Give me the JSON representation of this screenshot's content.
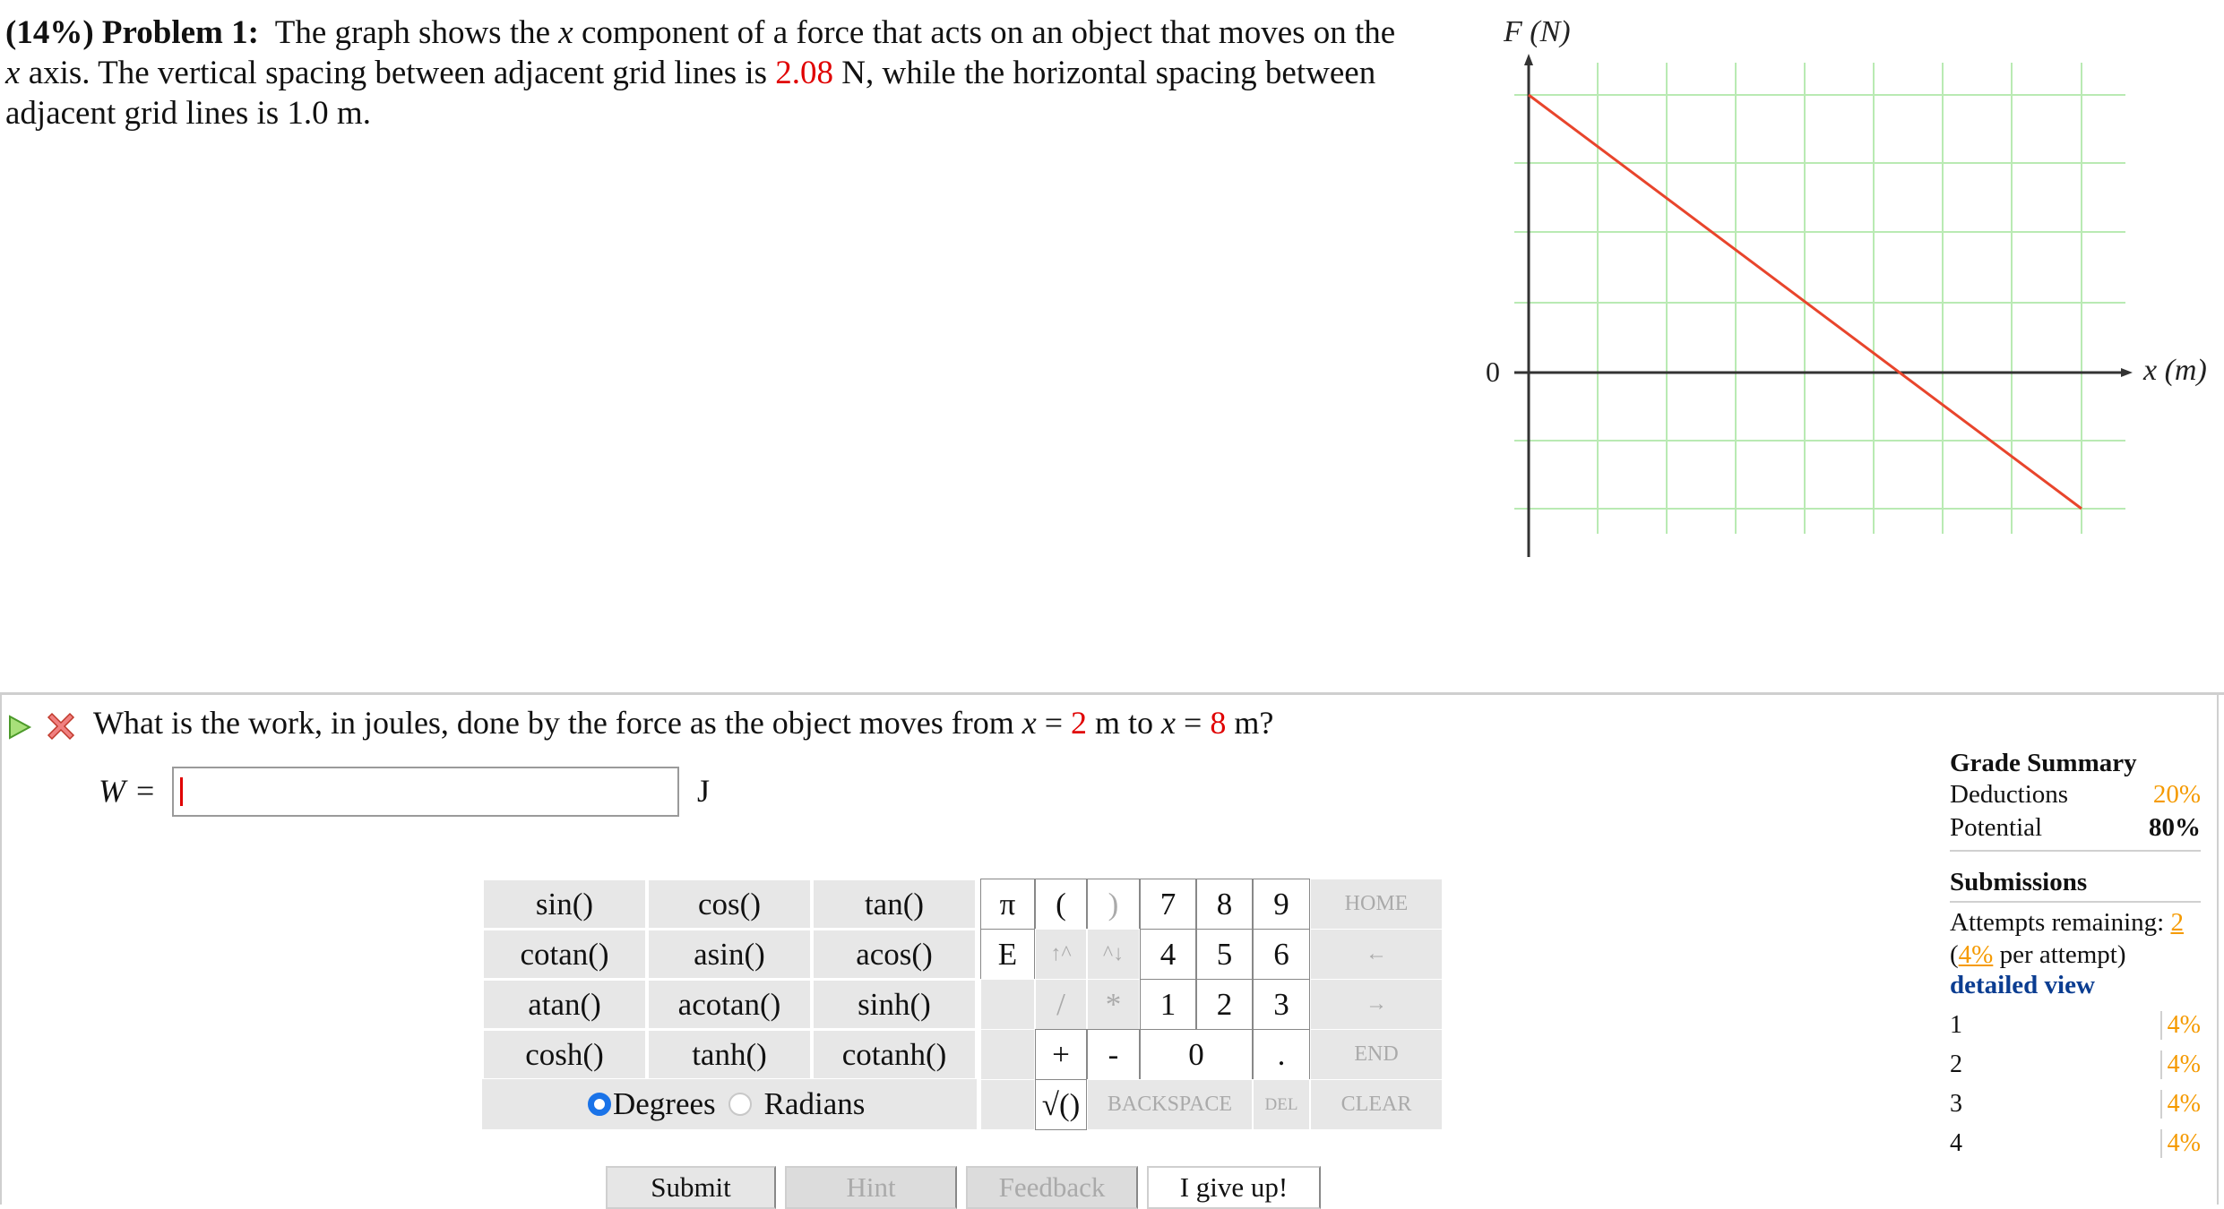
{
  "problem": {
    "weight": "(14%)",
    "title": "Problem 1:",
    "text_1": "The graph shows the",
    "var_x": "x",
    "text_2": "component of a force that acts on an object that moves on the",
    "var_x2": "x",
    "text_3": "axis. The vertical spacing between adjacent grid lines is",
    "spacing_value": "2.08",
    "text_4": "N, while the horizontal spacing between adjacent grid lines is 1.0 m."
  },
  "graph": {
    "y_axis_label": "F (N)",
    "x_axis_label": "x (m)",
    "origin_label": "0",
    "line_color": "#e8452c",
    "grid_color": "#b9eab3"
  },
  "question": {
    "text_1": "What is the work, in joules, done by the force as the object moves from",
    "var_1": "x",
    "eq_1": "=",
    "from_value": "2",
    "text_2": "m to",
    "var_2": "x",
    "eq_2": "=",
    "to_value": "8",
    "text_3": "m?"
  },
  "answer": {
    "variable": "W",
    "equals": "=",
    "value": "",
    "unit": "J"
  },
  "keypad": {
    "functions": [
      [
        "sin()",
        "cos()",
        "tan()"
      ],
      [
        "cotan()",
        "asin()",
        "acos()"
      ],
      [
        "atan()",
        "acotan()",
        "sinh()"
      ],
      [
        "cosh()",
        "tanh()",
        "cotanh()"
      ]
    ],
    "mode_degrees": "Degrees",
    "mode_radians": "Radians",
    "pi": "π",
    "e": "E",
    "open_paren": "(",
    "close_paren": ")",
    "up_caret": "↑^",
    "down_caret": "^↓",
    "slash": "/",
    "star": "*",
    "plus": "+",
    "minus": "-",
    "sqrt": "√()",
    "backspace": "BACKSPACE",
    "del": "DEL",
    "clear": "CLEAR",
    "home": "HOME",
    "left_arrow": "←",
    "right_arrow": "→",
    "end": "END",
    "dot": ".",
    "digits": [
      "7",
      "8",
      "9",
      "4",
      "5",
      "6",
      "1",
      "2",
      "3",
      "0"
    ]
  },
  "buttons": {
    "submit": "Submit",
    "hint": "Hint",
    "feedback": "Feedback",
    "give_up": "I give up!"
  },
  "grade_summary": {
    "title": "Grade Summary",
    "deductions_label": "Deductions",
    "deductions_value": "20%",
    "potential_label": "Potential",
    "potential_value": "80%",
    "submissions_title": "Submissions",
    "attempts_label": "Attempts remaining:",
    "attempts_value": "2",
    "per_attempt_pct": "4%",
    "per_attempt_text": "per attempt)",
    "open_paren": "(",
    "detailed_view": "detailed view",
    "attempts": [
      {
        "n": "1",
        "pct": "4%"
      },
      {
        "n": "2",
        "pct": "4%"
      },
      {
        "n": "3",
        "pct": "4%"
      },
      {
        "n": "4",
        "pct": "4%"
      }
    ]
  }
}
